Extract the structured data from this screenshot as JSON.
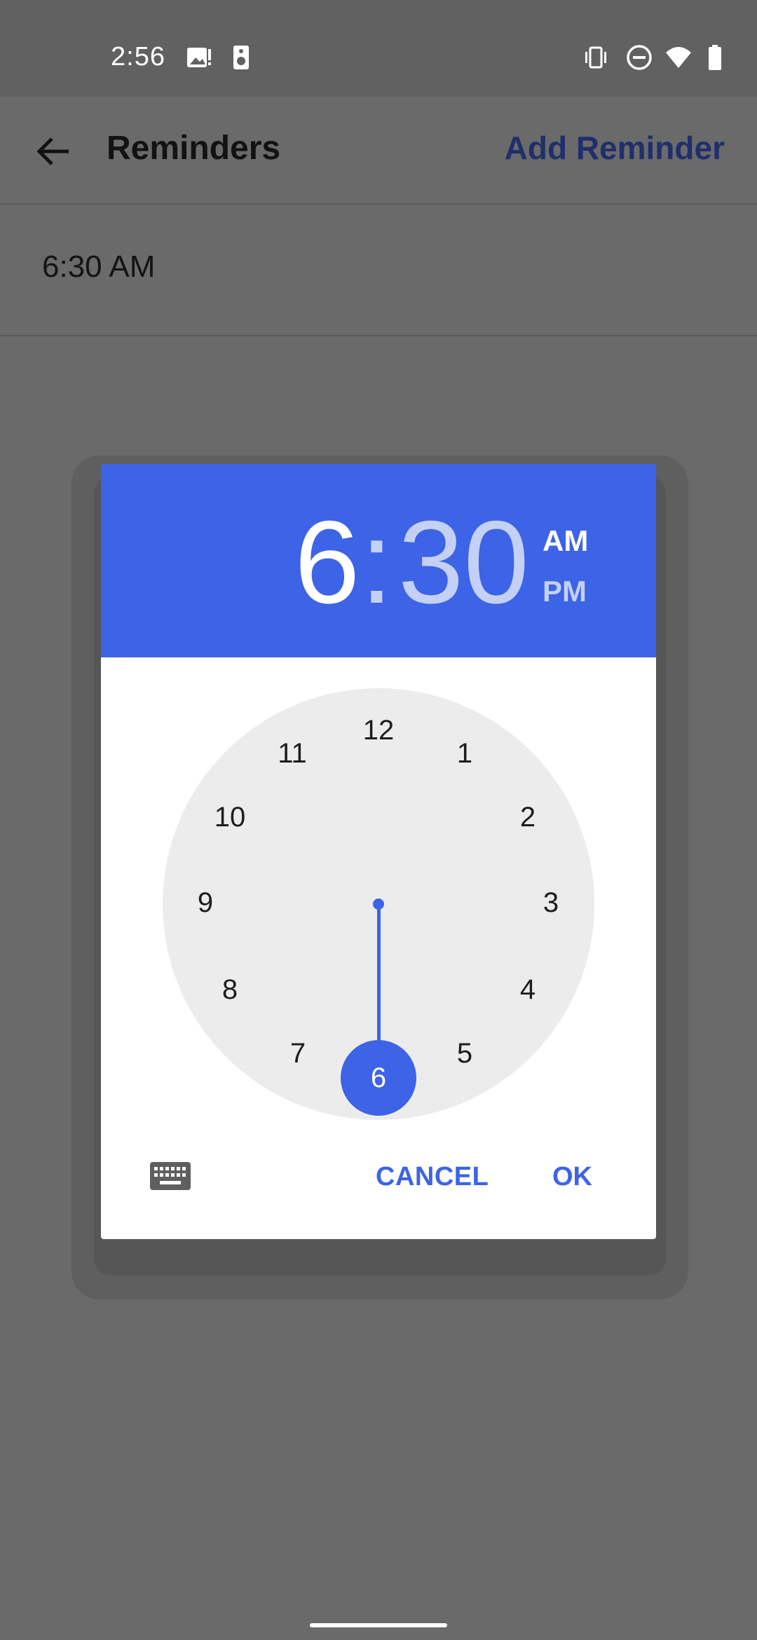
{
  "status_bar": {
    "time": "2:56",
    "left_icons": [
      "image-alert-icon",
      "speaker-icon"
    ],
    "right_icons": [
      "vibrate-icon",
      "do-not-disturb-icon",
      "wifi-icon",
      "battery-icon"
    ]
  },
  "app_bar": {
    "title": "Reminders",
    "back_icon": "arrow-back-icon",
    "action_label": "Add Reminder"
  },
  "reminders": [
    {
      "time": "6:30 AM"
    }
  ],
  "time_picker": {
    "hour": "6",
    "separator": ":",
    "minute": "30",
    "am_label": "AM",
    "pm_label": "PM",
    "selected_period": "AM",
    "selected_hour": "6",
    "clock_numbers": [
      "12",
      "1",
      "2",
      "3",
      "4",
      "5",
      "6",
      "7",
      "8",
      "9",
      "10",
      "11"
    ],
    "keyboard_icon": "keyboard-icon",
    "cancel_label": "CANCEL",
    "ok_label": "OK",
    "accent_color": "#3d63e6"
  }
}
